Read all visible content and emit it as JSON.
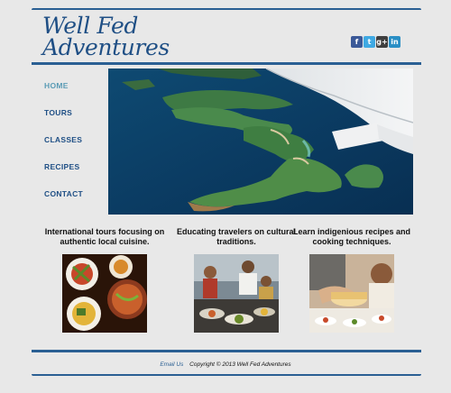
{
  "header": {
    "logo_line1": "Well Fed",
    "logo_line2": "Adventures",
    "social": [
      {
        "name": "facebook",
        "glyph": "f"
      },
      {
        "name": "twitter",
        "glyph": "t"
      },
      {
        "name": "google-plus",
        "glyph": "g+"
      },
      {
        "name": "linkedin",
        "glyph": "in"
      }
    ]
  },
  "nav": {
    "items": [
      {
        "label": "HOME",
        "active": true
      },
      {
        "label": "TOURS"
      },
      {
        "label": "CLASSES"
      },
      {
        "label": "RECIPES"
      },
      {
        "label": "CONTACT"
      }
    ]
  },
  "hero": {
    "icon": "aerial-island-photo"
  },
  "features": [
    {
      "text": "International tours focusing on authentic local cuisine.",
      "icon": "food-plates-photo"
    },
    {
      "text": "Educating travelers on cultural traditions.",
      "icon": "market-cooks-photo"
    },
    {
      "text": "Learn indigenious recipes and cooking techniques.",
      "icon": "cooking-class-photo"
    }
  ],
  "footer": {
    "email_label": "Email Us",
    "copyright": "Copyright © 2013 Well Fed Adventures"
  },
  "colors": {
    "brand_blue": "#2a5f93",
    "active_nav": "#5a9bb5",
    "background": "#e8e8e8"
  }
}
